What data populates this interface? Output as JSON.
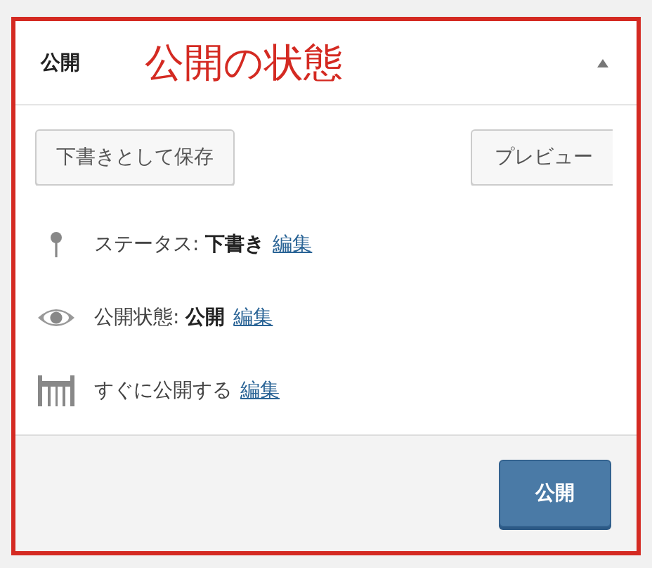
{
  "annotation": {
    "label": "公開の状態"
  },
  "panel": {
    "title": "公開",
    "buttons": [
      {
        "label": "下書きとして保存"
      },
      {
        "label": "プレビュー"
      }
    ],
    "rows": [
      {
        "kind": "status",
        "text": "ステータス: **下書き**",
        "link": "編集"
      },
      {
        "kind": "visibility",
        "text": "公開状態: **公開**",
        "link": "編集"
      },
      {
        "kind": "schedule",
        "text": "すぐに公開する",
        "link": "編集"
      }
    ],
    "publish_button": "公開"
  }
}
